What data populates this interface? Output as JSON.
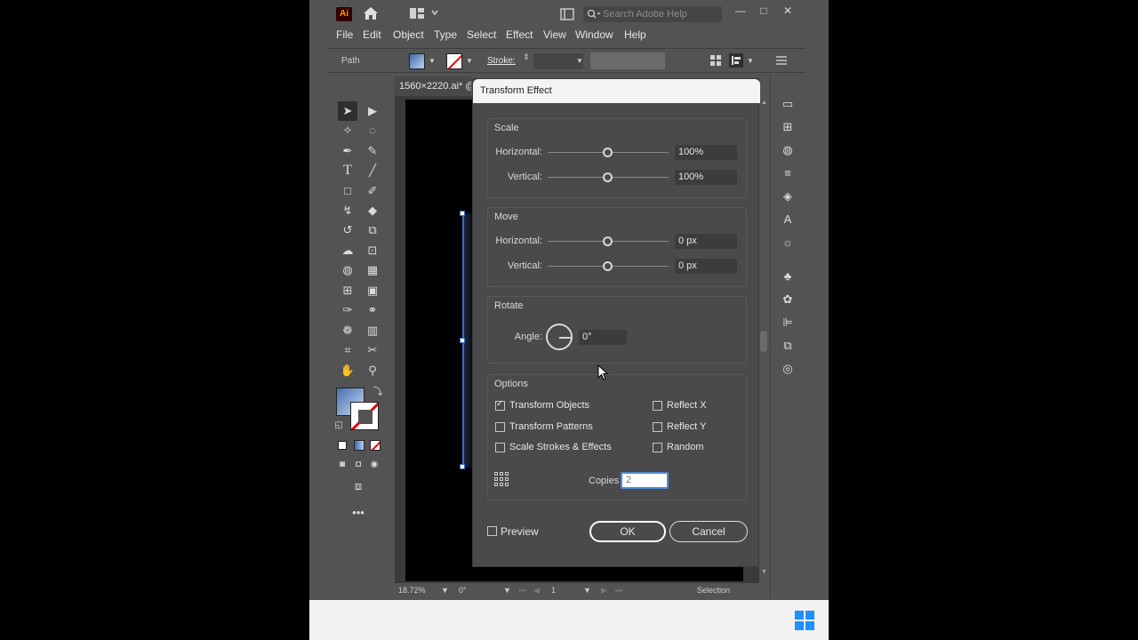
{
  "app": {
    "logo_text": "Ai",
    "search_placeholder": "Search Adobe Help",
    "window_controls": [
      "—",
      "□",
      "✕"
    ]
  },
  "menu": [
    "File",
    "Edit",
    "Object",
    "Type",
    "Select",
    "Effect",
    "View",
    "Window",
    "Help"
  ],
  "control_bar": {
    "selection_label": "Path",
    "stroke_label": "Stroke:"
  },
  "document": {
    "tab_label": "1560×2220.ai* @",
    "zoom": "18.72%",
    "rotation": "0°",
    "artboard_number": "1",
    "status_text": "Selection"
  },
  "dialog": {
    "title": "Transform Effect",
    "scale": {
      "title": "Scale",
      "horizontal_label": "Horizontal:",
      "horizontal_value": "100%",
      "vertical_label": "Vertical:",
      "vertical_value": "100%"
    },
    "move": {
      "title": "Move",
      "horizontal_label": "Horizontal:",
      "horizontal_value": "0 px",
      "vertical_label": "Vertical:",
      "vertical_value": "0 px"
    },
    "rotate": {
      "title": "Rotate",
      "angle_label": "Angle:",
      "angle_value": "0°"
    },
    "options": {
      "title": "Options",
      "transform_objects": "Transform Objects",
      "transform_patterns": "Transform Patterns",
      "scale_strokes": "Scale Strokes & Effects",
      "reflect_x": "Reflect X",
      "reflect_y": "Reflect Y",
      "random": "Random",
      "copies_label": "Copies",
      "copies_value": "2"
    },
    "preview_label": "Preview",
    "ok_label": "OK",
    "cancel_label": "Cancel"
  }
}
